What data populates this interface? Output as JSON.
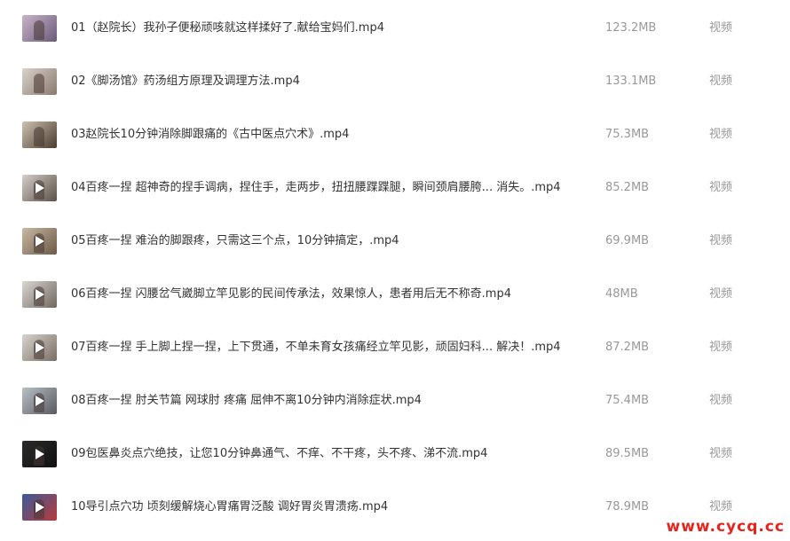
{
  "files": [
    {
      "name": "01（赵院长）我孙子便秘顽咳就这样揉好了.献给宝妈们.mp4",
      "size": "123.2MB",
      "type": "视频",
      "thumb_colors": [
        "#c9b4c8",
        "#6a5a7a"
      ],
      "play": false
    },
    {
      "name": "02《脚汤馆》药汤组方原理及调理方法.mp4",
      "size": "133.1MB",
      "type": "视频",
      "thumb_colors": [
        "#d8d2cc",
        "#8a7a6e"
      ],
      "play": false
    },
    {
      "name": "03赵院长10分钟消除脚跟痛的《古中医点穴术》.mp4",
      "size": "75.3MB",
      "type": "视频",
      "thumb_colors": [
        "#cfc2b0",
        "#4a3a30"
      ],
      "play": false
    },
    {
      "name": "04百疼一捏 超神奇的捏手调病，捏住手，走两步，扭扭腰蹀蹀腿，瞬间颈肩腰胯... 消失。.mp4",
      "size": "85.2MB",
      "type": "视频",
      "thumb_colors": [
        "#d5cfc8",
        "#5a5048"
      ],
      "play": true
    },
    {
      "name": "05百疼一捏 难治的脚跟疼，只需这三个点，10分钟搞定，.mp4",
      "size": "69.9MB",
      "type": "视频",
      "thumb_colors": [
        "#c8b8a4",
        "#6e5a46"
      ],
      "play": true
    },
    {
      "name": "06百疼一捏 闪腰岔气崴脚立竿见影的民间传承法，效果惊人，患者用后无不称奇.mp4",
      "size": "48MB",
      "type": "视频",
      "thumb_colors": [
        "#dad6d0",
        "#706860"
      ],
      "play": true
    },
    {
      "name": "07百疼一捏 手上脚上捏一捏，上下贯通，不单未育女孩痛经立竿见影，顽固妇科... 解决！.mp4",
      "size": "87.2MB",
      "type": "视频",
      "thumb_colors": [
        "#d8d4ce",
        "#7a6e64"
      ],
      "play": true
    },
    {
      "name": "08百疼一捏 肘关节篇 网球肘 疼痛 屈伸不离10分钟内消除症状.mp4",
      "size": "75.4MB",
      "type": "视频",
      "thumb_colors": [
        "#b8c0c8",
        "#5a5a60"
      ],
      "play": true
    },
    {
      "name": "09包医鼻炎点穴绝技，让您10分钟鼻通气、不痒、不干疼，头不疼、涕不流.mp4",
      "size": "89.5MB",
      "type": "视频",
      "thumb_colors": [
        "#2a2a2a",
        "#111111"
      ],
      "play": true
    },
    {
      "name": "10导引点穴功 顷刻缓解烧心胃痛胃泛酸 调好胃炎胃溃疡.mp4",
      "size": "78.9MB",
      "type": "视频",
      "thumb_colors": [
        "#3a5a9a",
        "#b83a3a"
      ],
      "play": true
    }
  ],
  "watermark": "www.cycq.cc"
}
